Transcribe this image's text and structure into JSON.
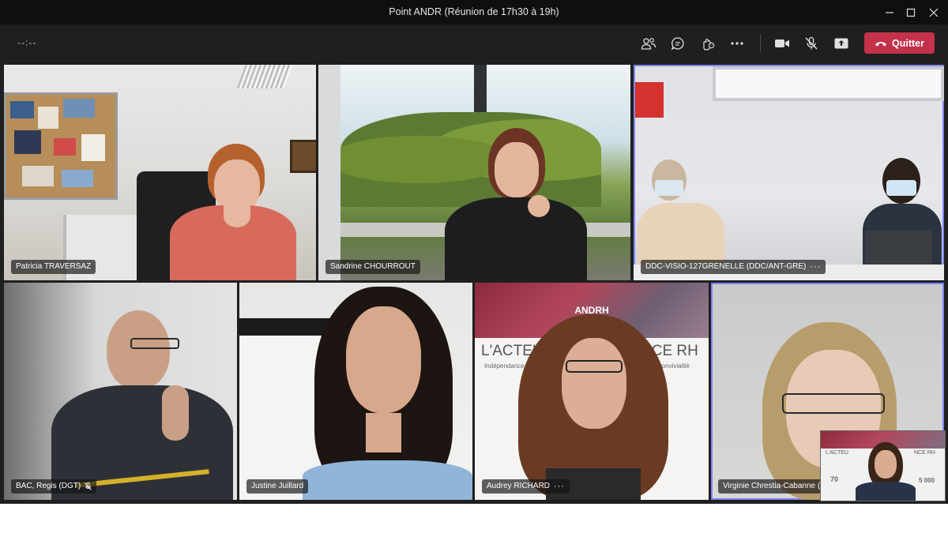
{
  "window": {
    "title": "Point ANDR (Réunion de 17h30 à 19h)",
    "controls": [
      "minimize",
      "maximize",
      "close"
    ]
  },
  "toolbar": {
    "timer": "--:--",
    "quit_label": "Quitter",
    "buttons": [
      "people-icon",
      "chat-icon",
      "reactions-icon",
      "more-icon",
      "camera-icon",
      "mic-off-icon",
      "share-icon"
    ]
  },
  "participants": [
    {
      "name": "Patricia TRAVERSAZ"
    },
    {
      "name": "Sandrine CHOURROUT"
    },
    {
      "name": "DDC-VISIO-127GRENELLE (DDC/ANT-GRE)"
    },
    {
      "name": "BAC, Regis (DGT)"
    },
    {
      "name": "Justine Juillard"
    },
    {
      "name": "Audrey RICHARD"
    },
    {
      "name": "Virginie Chrestia-Cabanne (Invi"
    }
  ],
  "banner": {
    "top": "L'ACTEU",
    "top2": "NCE RH",
    "sub": "Indépendance",
    "sub2": "· Convivialité",
    "brand": "ANDRH"
  },
  "pip": {
    "line1": "L'ACTEU",
    "line2": "NCE RH",
    "left": "70",
    "right": "5 000"
  },
  "colors": {
    "titlebar": "#0f0f0f",
    "toolbar": "#1f1f1f",
    "quit": "#c4314b",
    "active_outline": "#7f85f5"
  }
}
